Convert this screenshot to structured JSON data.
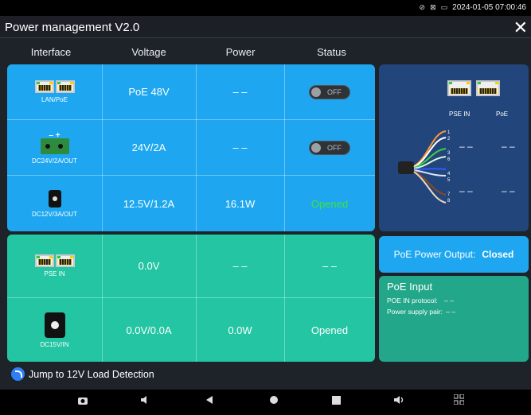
{
  "status_bar": {
    "datetime": "2024-01-05 07:00:46"
  },
  "app": {
    "title": "Power management V2.0",
    "close_glyph": "✕"
  },
  "table": {
    "headers": [
      "Interface",
      "Voltage",
      "Power",
      "Status"
    ],
    "rows": [
      {
        "interface": "LAN/PoE",
        "voltage": "PoE 48V",
        "power": "– –",
        "status": "OFF",
        "status_kind": "toggle"
      },
      {
        "interface": "DC24V/2A/OUT",
        "voltage": "24V/2A",
        "power": "– –",
        "status": "OFF",
        "status_kind": "toggle",
        "terminal_marks": "–  +"
      },
      {
        "interface": "DC12V/3A/OUT",
        "voltage": "12.5V/1.2A",
        "power": "16.1W",
        "status": "Opened",
        "status_kind": "text",
        "status_color": "#3de33d"
      },
      {
        "interface": "PSE IN",
        "voltage": "0.0V",
        "power": "– –",
        "status": "– –",
        "status_kind": "text"
      },
      {
        "interface": "DC15V/IN",
        "voltage": "0.0V/0.0A",
        "power": "0.0W",
        "status": "Opened",
        "status_kind": "text"
      }
    ]
  },
  "diagram": {
    "port_labels": [
      "PSE IN",
      "PoE"
    ],
    "pins": [
      "1",
      "2",
      "3",
      "6",
      "4",
      "5",
      "7",
      "8"
    ],
    "values": [
      "– –",
      "– –",
      "– –",
      "– –"
    ]
  },
  "poe_output": {
    "label": "PoE Power Output:",
    "state": "Closed"
  },
  "poe_input": {
    "title": "PoE Input",
    "protocol_label": "POE IN protocol:",
    "protocol_value": "– –",
    "pair_label": "Power supply pair:",
    "pair_value": "– –"
  },
  "jump_link": "Jump to 12V Load Detection",
  "colors": {
    "blue_panel": "#1ea7f0",
    "green_panel": "#23c5a2",
    "diagram_bg": "#22457c",
    "opened_green": "#3de33d"
  },
  "navbar_icons": [
    "camera-icon",
    "volume-down-icon",
    "back-icon",
    "home-icon",
    "recents-icon",
    "volume-up-icon",
    "grid-icon"
  ]
}
